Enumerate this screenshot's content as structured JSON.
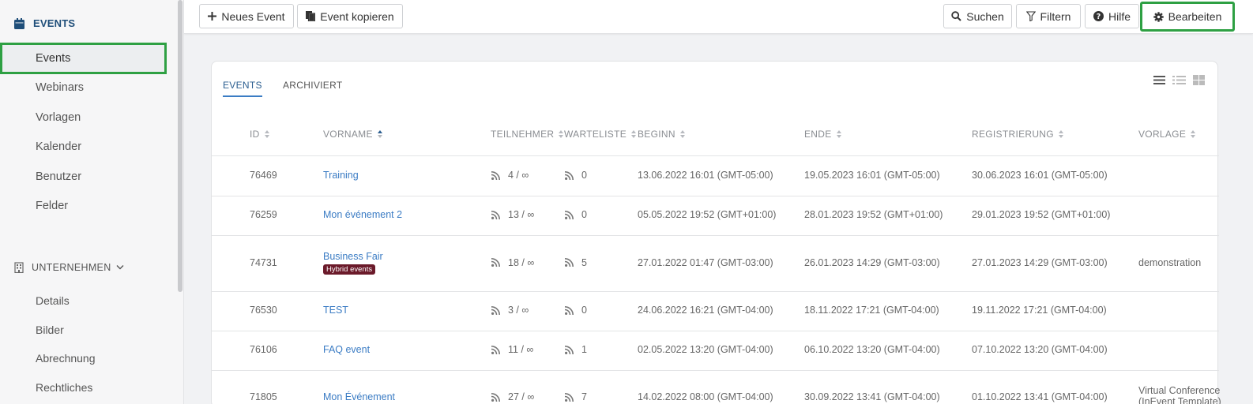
{
  "sidebar": {
    "section_title": "EVENTS",
    "items": [
      {
        "label": "Events",
        "active": true
      },
      {
        "label": "Webinars"
      },
      {
        "label": "Vorlagen"
      },
      {
        "label": "Kalender"
      },
      {
        "label": "Benutzer"
      },
      {
        "label": "Felder"
      }
    ],
    "company_section": "UNTERNEHMEN",
    "company_items": [
      {
        "label": "Details"
      },
      {
        "label": "Bilder"
      },
      {
        "label": "Abrechnung"
      },
      {
        "label": "Rechtliches"
      }
    ]
  },
  "toolbar": {
    "new_event": "Neues Event",
    "copy_event": "Event kopieren",
    "search": "Suchen",
    "filter": "Filtern",
    "help": "Hilfe",
    "edit": "Bearbeiten"
  },
  "tabs": [
    {
      "label": "EVENTS",
      "active": true
    },
    {
      "label": "ARCHIVIERT"
    }
  ],
  "table": {
    "columns": [
      "ID",
      "VORNAME",
      "TEILNEHMER",
      "WARTELISTE",
      "BEGINN",
      "ENDE",
      "REGISTRIERUNG",
      "VORLAGE"
    ],
    "rows": [
      {
        "id": "76469",
        "name": "Training",
        "badge": "",
        "participants": "4 / ∞",
        "waitlist": "0",
        "start": "13.06.2022 16:01 (GMT-05:00)",
        "end": "19.05.2023 16:01 (GMT-05:00)",
        "registration": "30.06.2023 16:01 (GMT-05:00)",
        "template": ""
      },
      {
        "id": "76259",
        "name": "Mon événement 2",
        "badge": "",
        "participants": "13 / ∞",
        "waitlist": "0",
        "start": "05.05.2022 19:52 (GMT+01:00)",
        "end": "28.01.2023 19:52 (GMT+01:00)",
        "registration": "29.01.2023 19:52 (GMT+01:00)",
        "template": ""
      },
      {
        "id": "74731",
        "name": "Business Fair",
        "badge": "Hybrid events",
        "participants": "18 / ∞",
        "waitlist": "5",
        "start": "27.01.2022 01:47 (GMT-03:00)",
        "end": "26.01.2023 14:29 (GMT-03:00)",
        "registration": "27.01.2023 14:29 (GMT-03:00)",
        "template": "demonstration"
      },
      {
        "id": "76530",
        "name": "TEST",
        "badge": "",
        "participants": "3 / ∞",
        "waitlist": "0",
        "start": "24.06.2022 16:21 (GMT-04:00)",
        "end": "18.11.2022 17:21 (GMT-04:00)",
        "registration": "19.11.2022 17:21 (GMT-04:00)",
        "template": ""
      },
      {
        "id": "76106",
        "name": "FAQ event",
        "badge": "",
        "participants": "11 / ∞",
        "waitlist": "1",
        "start": "02.05.2022 13:20 (GMT-04:00)",
        "end": "06.10.2022 13:20 (GMT-04:00)",
        "registration": "07.10.2022 13:20 (GMT-04:00)",
        "template": ""
      },
      {
        "id": "71805",
        "name": "Mon Événement",
        "badge": "",
        "participants": "27 / ∞",
        "waitlist": "7",
        "start": "14.02.2022 08:00 (GMT-04:00)",
        "end": "30.09.2022 13:41 (GMT-04:00)",
        "registration": "01.10.2022 13:41 (GMT-04:00)",
        "template": "Virtual Conference (InEvent Template)"
      }
    ]
  }
}
